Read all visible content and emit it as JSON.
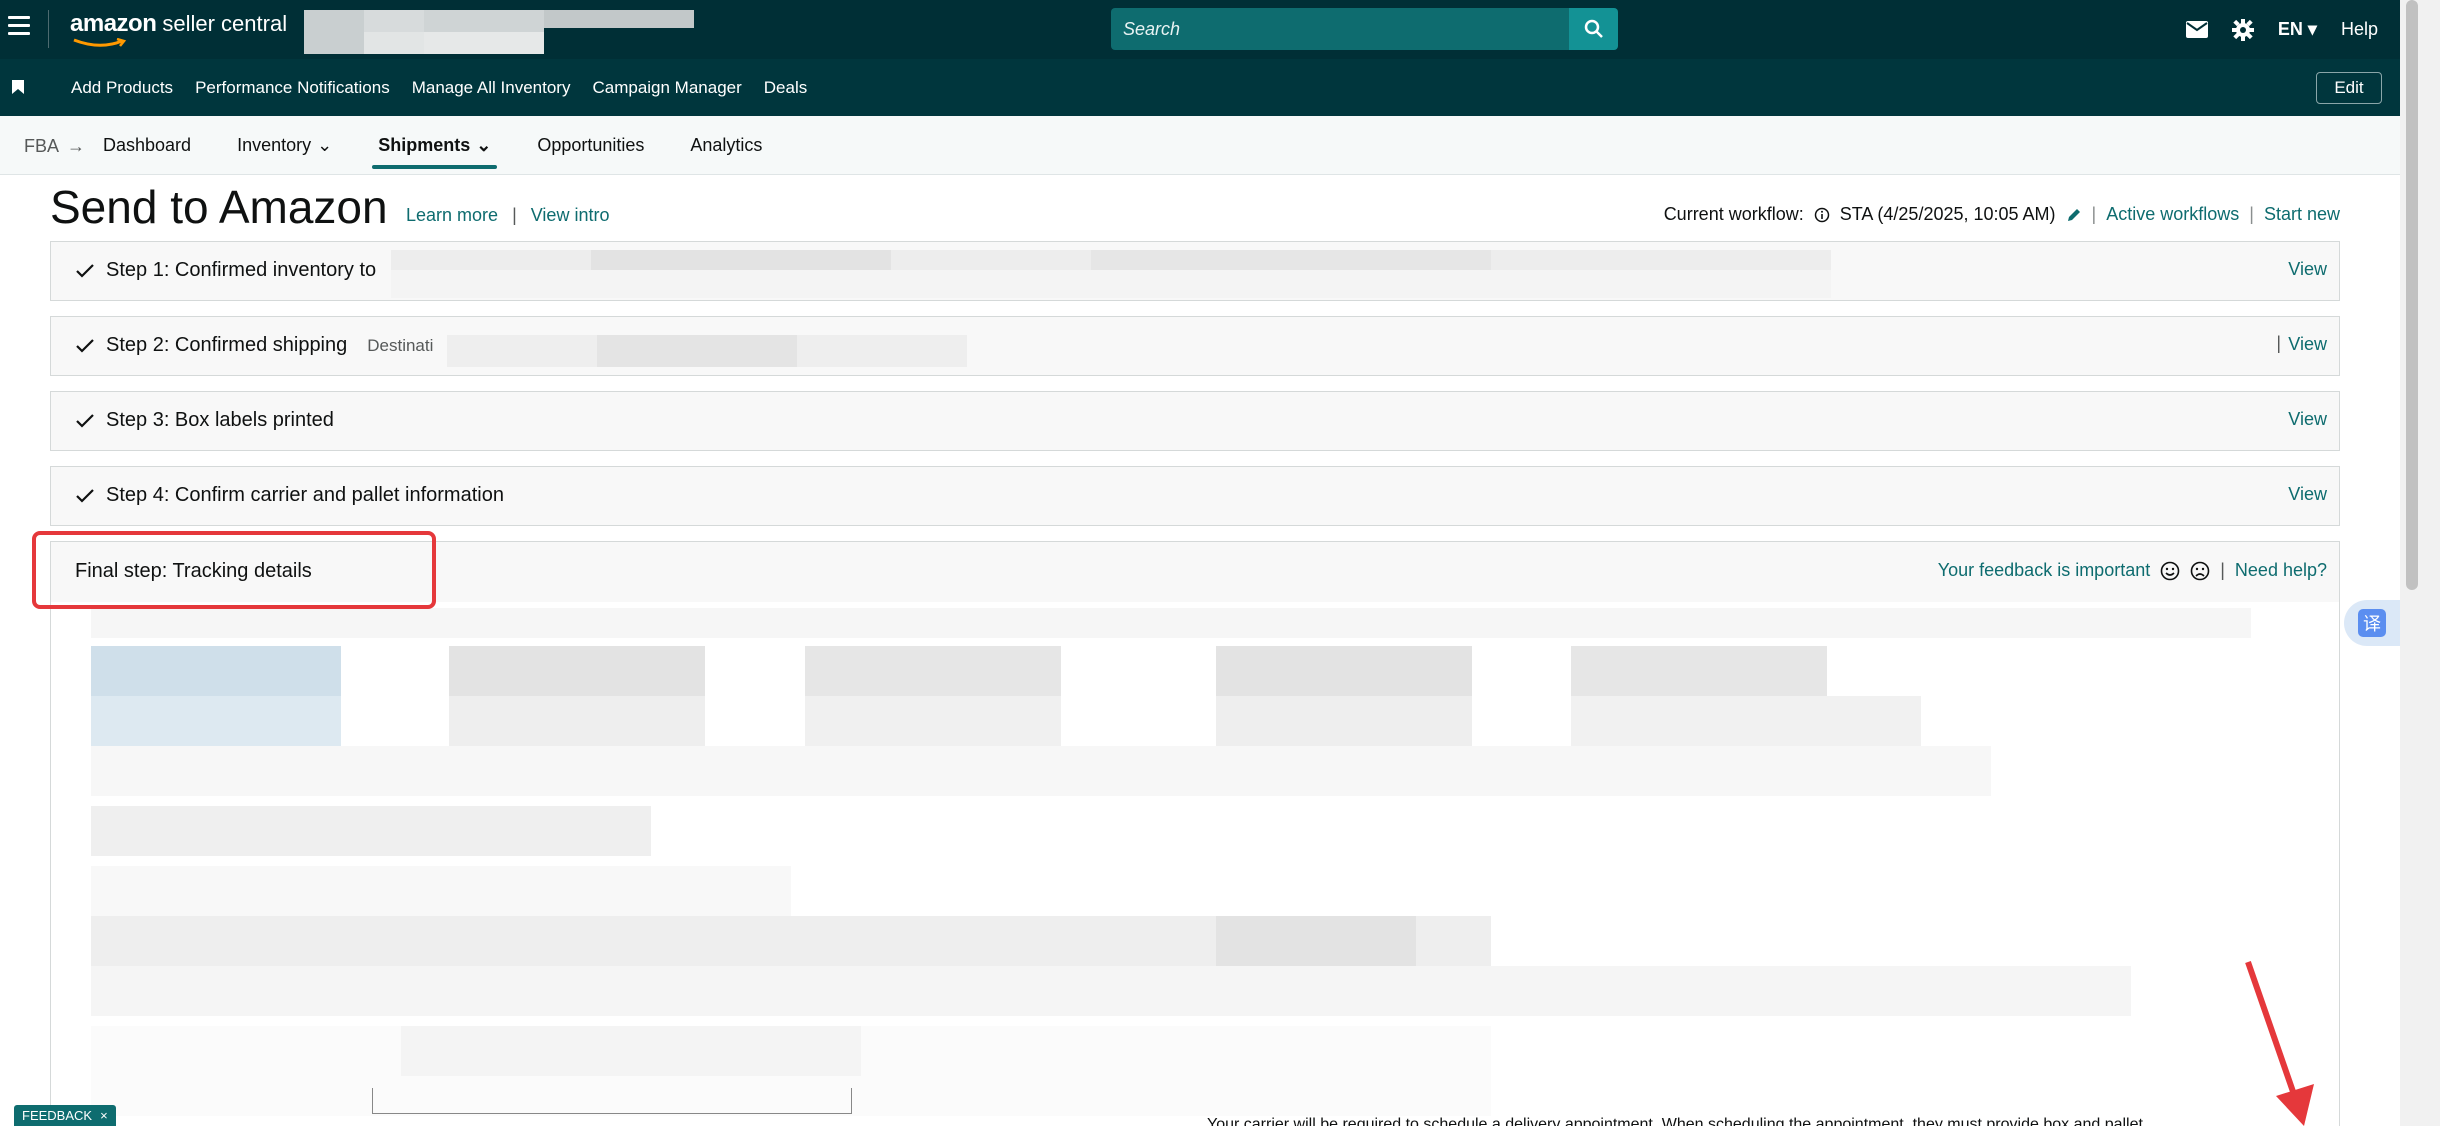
{
  "header": {
    "logo_word": "amazon",
    "logo_suffix": "seller central",
    "search_placeholder": "Search",
    "lang": "EN",
    "help": "Help"
  },
  "bookmarks": {
    "items": [
      "Add Products",
      "Performance Notifications",
      "Manage All Inventory",
      "Campaign Manager",
      "Deals"
    ],
    "edit": "Edit"
  },
  "subnav": {
    "crumb": "FBA",
    "tabs": [
      "Dashboard",
      "Inventory",
      "Shipments",
      "Opportunities",
      "Analytics"
    ]
  },
  "page": {
    "title": "Send to Amazon",
    "learn_more": "Learn more",
    "view_intro": "View intro",
    "workflow_label": "Current workflow:",
    "workflow_value": "STA (4/25/2025, 10:05 AM)",
    "active_workflows": "Active workflows",
    "start_new": "Start new"
  },
  "steps": [
    {
      "label": "Step 1: Confirmed inventory to",
      "sub": "",
      "view": "View"
    },
    {
      "label": "Step 2: Confirmed shipping",
      "sub": "Destinati",
      "view": "View"
    },
    {
      "label": "Step 3: Box labels printed",
      "sub": "",
      "view": "View"
    },
    {
      "label": "Step 4: Confirm carrier and pallet information",
      "sub": "",
      "view": "View"
    }
  ],
  "final": {
    "title": "Final step: Tracking details",
    "feedback": "Your feedback is important",
    "need_help": "Need help?"
  },
  "bottom_text": "Your carrier will be required to schedule a delivery appointment. When scheduling the appointment, they must provide box and pallet",
  "feedback_tab": "FEEDBACK",
  "translate_glyph": "译",
  "colors": {
    "topbar": "#002f36",
    "accent": "#0e6c6f",
    "highlight": "#e5383b"
  }
}
